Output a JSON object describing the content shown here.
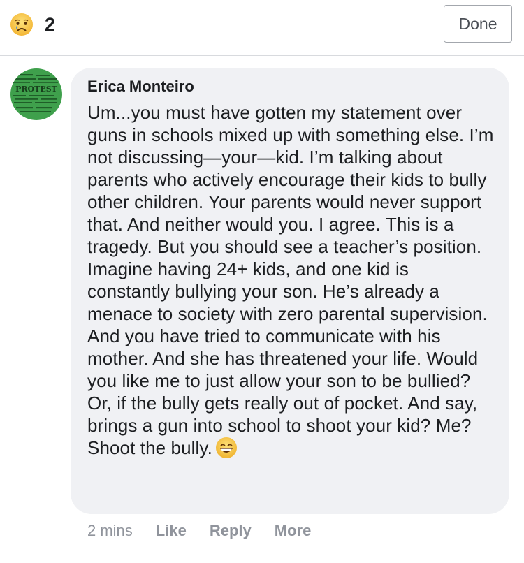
{
  "header": {
    "reaction_icon": "sad-face-icon",
    "reaction_count": "2",
    "done_label": "Done"
  },
  "comment": {
    "avatar_text": "PROTEST",
    "avatar_color": "#3fa04c",
    "author": "Erica Monteiro",
    "text": "Um...you must have gotten my statement over guns in schools mixed up with something else. I’m not discussing—your—kid. I’m talking about parents who actively encourage their kids to bully other children. Your parents would never support that. And neither would you. I agree. This is a tragedy. But you should see a teacher’s position. Imagine having 24+ kids, and one kid is constantly bullying your son. He’s already a menace to society with zero parental supervision. And you have tried to communicate with his mother. And she has threatened your life. Would you like me to just allow your son to be bullied? Or, if the bully gets really out of pocket. And say, brings a gun into school to shoot your kid? Me? Shoot the bully.",
    "trailing_emoji": "grinning-face-icon",
    "timestamp": "2 mins",
    "actions": {
      "like": "Like",
      "reply": "Reply",
      "more": "More"
    }
  },
  "colors": {
    "bubble_bg": "#f0f1f4",
    "meta_gray": "#90949c",
    "text": "#1c1e21",
    "divider": "#d8dade"
  }
}
